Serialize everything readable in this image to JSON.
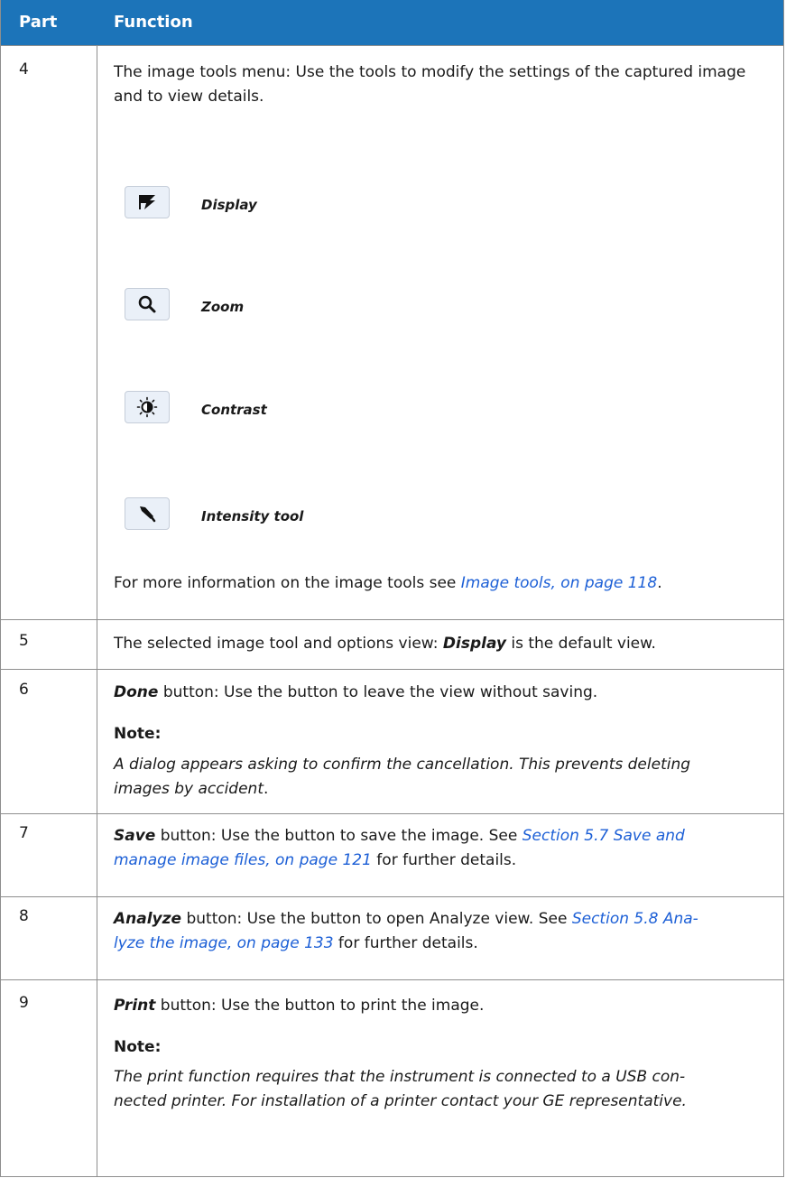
{
  "header": {
    "part": "Part",
    "function": "Function"
  },
  "row4": {
    "num": "4",
    "intro": "The image tools menu: Use the tools to modify the settings of the captured image and to view details.",
    "tools": [
      {
        "label": "Display",
        "icon": "display-icon"
      },
      {
        "label": "Zoom",
        "icon": "zoom-icon"
      },
      {
        "label": "Contrast",
        "icon": "contrast-icon"
      },
      {
        "label": "Intensity tool",
        "icon": "intensity-dropper-icon"
      }
    ],
    "more_prefix": "For more information on the image tools see ",
    "more_link": "Image tools, on page 118",
    "more_suffix": "."
  },
  "row5": {
    "num": "5",
    "text_a": "The selected image tool and options view: ",
    "bold": "Display",
    "text_b": " is the default view."
  },
  "row6": {
    "num": "6",
    "bold": "Done",
    "text": " button: Use the button to leave the view without saving.",
    "note_label": "Note:",
    "note_line1": "A dialog appears asking to confirm the cancellation. This prevents deleting",
    "note_line2": "images by accident",
    "note_end": "."
  },
  "row7": {
    "num": "7",
    "bold": "Save",
    "text_a": " button: Use the button to save the image. See ",
    "link_1": "Section 5.7 Save and",
    "link_2": "manage image files, on page 121",
    "text_b": " for further details."
  },
  "row8": {
    "num": "8",
    "bold": "Analyze",
    "text_a": " button: Use the button to open Analyze view. See ",
    "link_1": "Section 5.8 Ana-",
    "link_2": "lyze the image, on page 133",
    "text_b": " for further details."
  },
  "row9": {
    "num": "9",
    "bold": "Print",
    "text": " button: Use the button to print the image.",
    "note_label": "Note:",
    "note_line1": "The print function requires that the instrument is connected to a USB con-",
    "note_line2": "nected printer. For installation of a printer contact your GE representative."
  }
}
